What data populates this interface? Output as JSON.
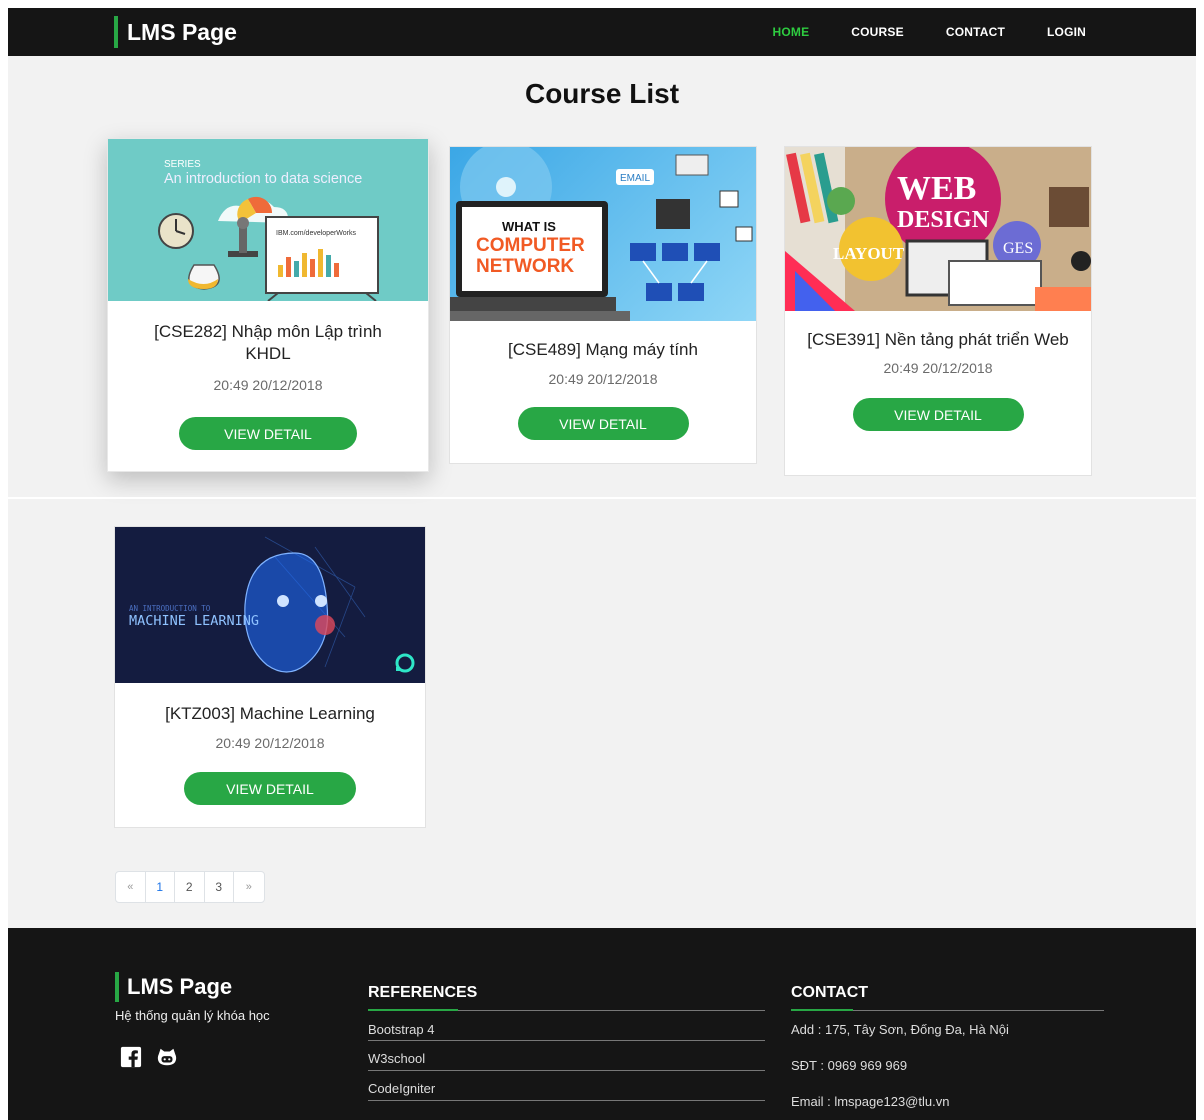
{
  "header": {
    "brand": "LMS Page",
    "nav": [
      {
        "label": "HOME",
        "active": true
      },
      {
        "label": "COURSE",
        "active": false
      },
      {
        "label": "CONTACT",
        "active": false
      },
      {
        "label": "LOGIN",
        "active": false
      }
    ]
  },
  "page_title": "Course List",
  "courses": [
    {
      "title": "[CSE282] Nhập môn Lập trình KHDL",
      "date": "20:49 20/12/2018",
      "button": "VIEW DETAIL",
      "thumb": {
        "series": "SERIES",
        "heading": "An introduction to data science",
        "url": "IBM.com/developerWorks"
      }
    },
    {
      "title": "[CSE489] Mạng máy tính",
      "date": "20:49 20/12/2018",
      "button": "VIEW DETAIL",
      "thumb": {
        "line1": "WHAT IS",
        "line2": "COMPUTER",
        "line3": "NETWORK",
        "tag": "EMAIL"
      }
    },
    {
      "title": "[CSE391] Nền tảng phát triển Web",
      "date": "20:49 20/12/2018",
      "button": "VIEW DETAIL",
      "thumb": {
        "line1": "WEB",
        "line2": "DESIGN",
        "tag1": "LAYOUT",
        "tag2": "GES"
      }
    },
    {
      "title": "[KTZ003] Machine Learning",
      "date": "20:49 20/12/2018",
      "button": "VIEW DETAIL",
      "thumb": {
        "small": "AN INTRODUCTION TO",
        "big": "MACHINE LEARNING"
      }
    }
  ],
  "pagination": {
    "prev": "«",
    "pages": [
      "1",
      "2",
      "3"
    ],
    "next": "»",
    "active": "1"
  },
  "footer": {
    "brand": "LMS Page",
    "subtitle": "Hệ thống quản lý khóa học",
    "social": [
      "facebook-icon",
      "github-icon"
    ],
    "references_title": "REFERENCES",
    "references": [
      "Bootstrap 4",
      "W3school",
      "CodeIgniter"
    ],
    "contact_title": "CONTACT",
    "contact": [
      "Add : 175, Tây Sơn, Đống Đa, Hà Nội",
      "SĐT : 0969 969 969",
      "Email : lmspage123@tlu.vn"
    ]
  },
  "colors": {
    "accent": "#28a745",
    "nav_active": "#2ecc40",
    "dark": "#151515",
    "link_active": "#1a73e8"
  }
}
